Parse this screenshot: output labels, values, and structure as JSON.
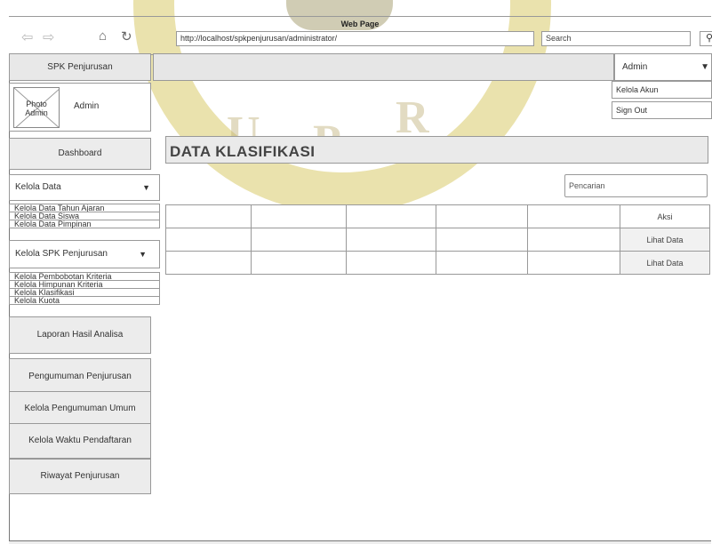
{
  "browser": {
    "title": "Web Page",
    "url": "http://localhost/spkpenjurusan/administrator/",
    "search_placeholder": "Search",
    "back_icon": "arrow-left-icon",
    "forward_icon": "arrow-right-icon",
    "home_icon": "home-icon",
    "reload_icon": "reload-icon",
    "search_icon": "magnifier-icon"
  },
  "sidebar": {
    "brand": "SPK Penjurusan",
    "photo_label": "Photo Admin",
    "profile_name": "Admin",
    "dashboard": "Dashboard",
    "kelola_data": "Kelola Data",
    "kelola_data_items": [
      "Kelola Data Tahun Ajaran",
      "Kelola Data Siswa",
      "Kelola Data Pimpinan"
    ],
    "kelola_spk": "Kelola SPK Penjurusan",
    "kelola_spk_items": [
      "Kelola Pembobotan Kriteria",
      "Kelola Himpunan Kriteria",
      "Kelola Klasifikasi",
      "Kelola Kuota"
    ],
    "buttons": [
      "Laporan Hasil Analisa",
      "Pengumuman Penjurusan",
      "Kelola Pengumuman Umum",
      "Kelola Waktu Pendaftaran",
      "Riwayat Penjurusan"
    ]
  },
  "header": {
    "admin_label": "Admin",
    "menu_items": [
      "Kelola Akun",
      "Sign Out"
    ]
  },
  "main": {
    "page_title": "DATA KLASIFIKASI",
    "search_placeholder": "Pencarian",
    "table": {
      "action_header": "Aksi",
      "rows": [
        {
          "action": "Lihat Data"
        },
        {
          "action": "Lihat Data"
        }
      ]
    }
  }
}
